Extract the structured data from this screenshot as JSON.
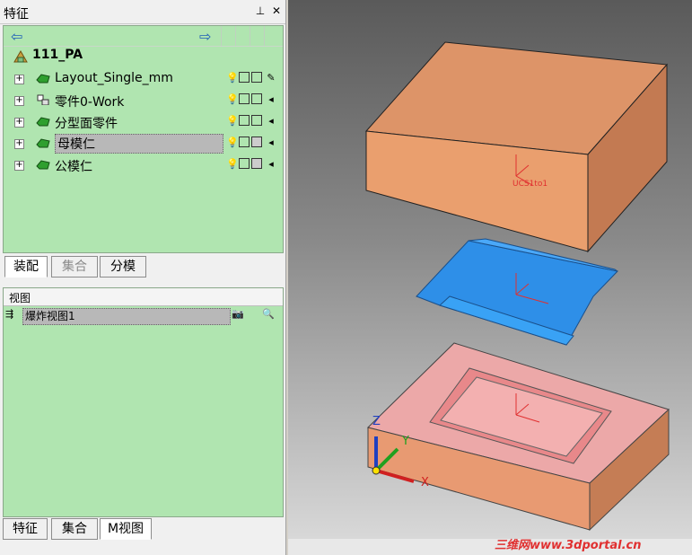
{
  "panel": {
    "title": "特征",
    "pin_icon": "pin-icon",
    "close_icon": "close-icon"
  },
  "tree": {
    "back_icon": "back-arrow-icon",
    "forward_icon": "forward-arrow-icon",
    "root": "111_PA",
    "items": [
      {
        "label": "Layout_Single_mm",
        "expander": "+"
      },
      {
        "label": "零件0-Work",
        "expander": "+"
      },
      {
        "label": "分型面零件",
        "expander": "+"
      },
      {
        "label": "母模仁",
        "expander": "+",
        "selected": true
      },
      {
        "label": "公模仁",
        "expander": "+"
      }
    ]
  },
  "upper_tabs": [
    "装配",
    "集合",
    "分模"
  ],
  "view_panel": {
    "header": "视图",
    "item": "爆炸视图1"
  },
  "lower_tabs": [
    "特征",
    "集合",
    "M视图"
  ],
  "viewport": {
    "ucs_label": "UCS1to1",
    "axis_x": "X",
    "axis_y": "Y",
    "axis_z": "Z"
  },
  "watermark": "三维网www.3dportal.cn",
  "colors": {
    "tree_bg": "#b0e5b0",
    "top_block": "#e49a6e",
    "middle_core": "#2e8fe8",
    "bottom_plate": "#eea8a8",
    "ucs_red": "#e03030"
  }
}
